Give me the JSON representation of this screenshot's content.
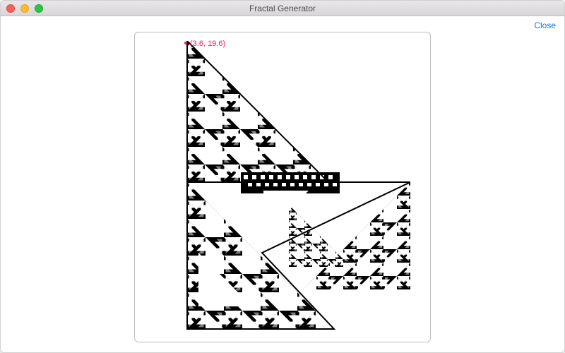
{
  "window": {
    "title": "Fractal Generator"
  },
  "toolbar": {
    "close_label": "Close"
  },
  "canvas": {
    "cursor_coord_label": "(3.6, 19.6)"
  }
}
